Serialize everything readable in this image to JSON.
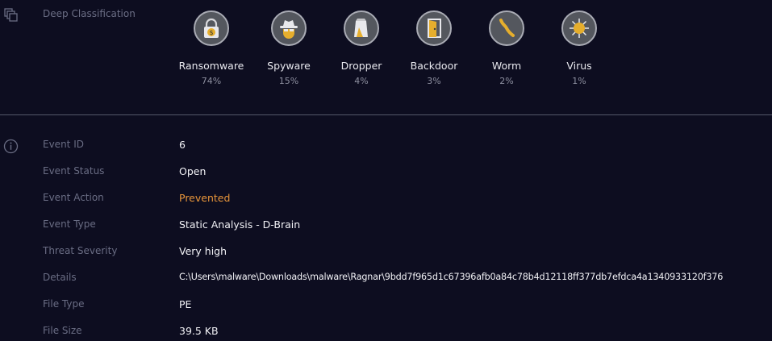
{
  "section_label": "Deep Classification",
  "classes": [
    {
      "name": "Ransomware",
      "pct": "74%",
      "icon": "ransomware-lock-icon"
    },
    {
      "name": "Spyware",
      "pct": "15%",
      "icon": "spy-icon"
    },
    {
      "name": "Dropper",
      "pct": "4%",
      "icon": "dropper-bag-icon"
    },
    {
      "name": "Backdoor",
      "pct": "3%",
      "icon": "door-icon"
    },
    {
      "name": "Worm",
      "pct": "2%",
      "icon": "worm-icon"
    },
    {
      "name": "Virus",
      "pct": "1%",
      "icon": "virus-icon"
    }
  ],
  "details": [
    {
      "label": "Event ID",
      "value": "6"
    },
    {
      "label": "Event Status",
      "value": "Open"
    },
    {
      "label": "Event Action",
      "value": "Prevented"
    },
    {
      "label": "Event Type",
      "value": "Static Analysis - D-Brain"
    },
    {
      "label": "Threat Severity",
      "value": "Very high"
    },
    {
      "label": "Details",
      "value": "C:\\Users\\malware\\Downloads\\malware\\Ragnar\\9bdd7f965d1c67396afb0a84c78b4d12118ff377db7efdca4a1340933120f376"
    },
    {
      "label": "File Type",
      "value": "PE"
    },
    {
      "label": "File Size",
      "value": "39.5 KB"
    }
  ],
  "colors": {
    "background": "#0d0d20",
    "accent_gold": "#e6ae2d",
    "action_orange": "#e8953a",
    "label_gray": "#6a6d84"
  }
}
